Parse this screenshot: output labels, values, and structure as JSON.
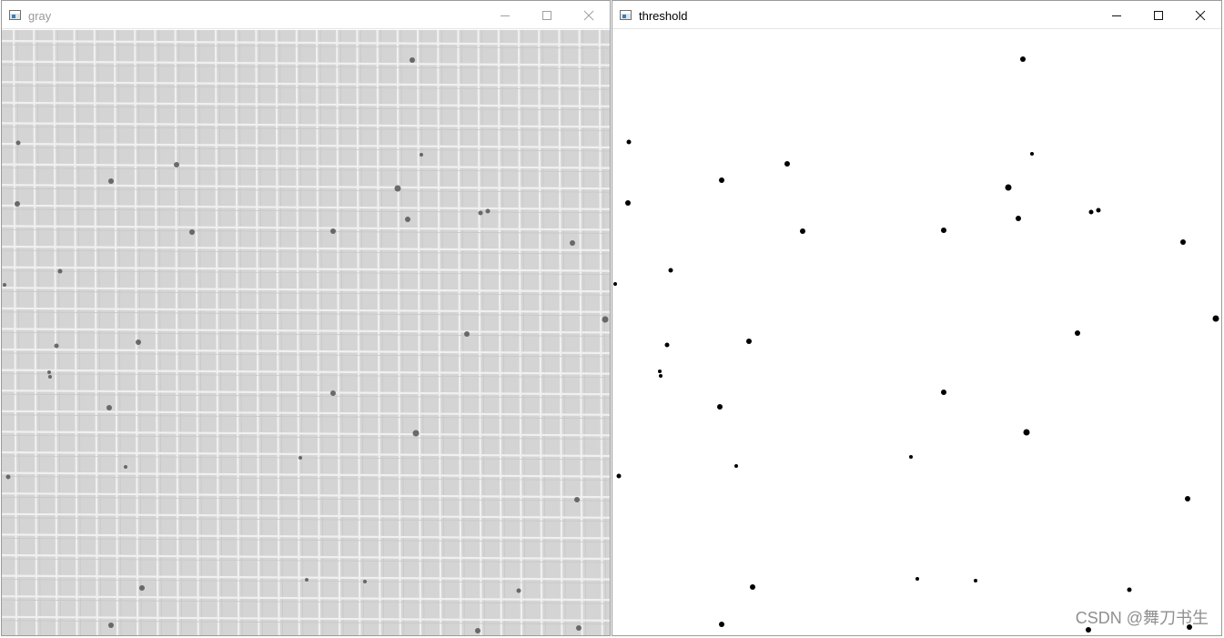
{
  "windows": {
    "gray": {
      "title": "gray"
    },
    "threshold": {
      "title": "threshold"
    }
  },
  "controls": {
    "minimize_icon": "minimize-icon",
    "maximize_icon": "maximize-icon",
    "close_icon": "close-icon"
  },
  "colors": {
    "gray_background": "#d4d4d4",
    "grid_line": "#f0f0f0",
    "cell": "#555555",
    "threshold_background": "#ffffff",
    "blob": "#000000"
  },
  "watermark": "CSDN @舞刀书生"
}
